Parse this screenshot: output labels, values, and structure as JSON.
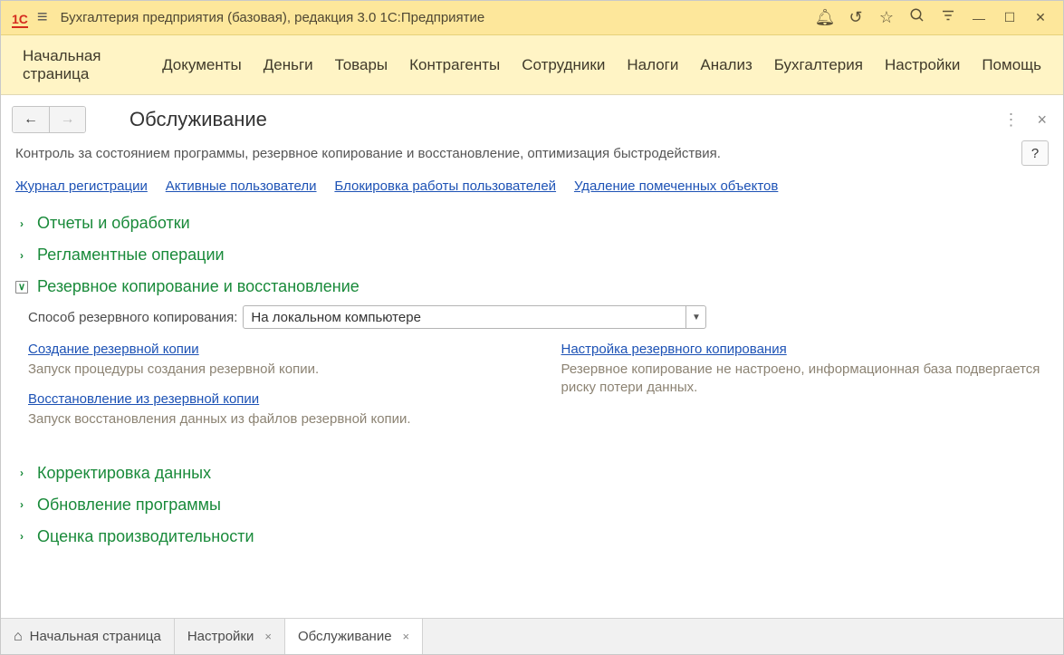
{
  "titlebar": {
    "logo_text": "1С",
    "app_title": "Бухгалтерия предприятия (базовая), редакция 3.0 1С:Предприятие"
  },
  "mainmenu": [
    "Начальная страница",
    "Документы",
    "Деньги",
    "Товары",
    "Контрагенты",
    "Сотрудники",
    "Налоги",
    "Анализ",
    "Бухгалтерия",
    "Настройки",
    "Помощь"
  ],
  "page": {
    "title": "Обслуживание",
    "description": "Контроль за состоянием программы, резервное копирование и восстановление, оптимизация быстродействия.",
    "help_label": "?"
  },
  "top_links": [
    "Журнал регистрации",
    "Активные пользователи",
    "Блокировка работы пользователей",
    "Удаление помеченных объектов"
  ],
  "sections": {
    "s1": "Отчеты и обработки",
    "s2": "Регламентные операции",
    "s3": "Резервное копирование и восстановление",
    "s4": "Корректировка данных",
    "s5": "Обновление программы",
    "s6": "Оценка производительности"
  },
  "backup": {
    "method_label": "Способ резервного копирования:",
    "method_value": "На локальном компьютере",
    "left": {
      "link1": "Создание резервной копии",
      "desc1": "Запуск процедуры создания резервной копии.",
      "link2": "Восстановление из резервной копии",
      "desc2": "Запуск восстановления данных из файлов резервной копии."
    },
    "right": {
      "link1": "Настройка резервного копирования",
      "desc1": "Резервное копирование не настроено, информационная база подвергается риску потери данных."
    }
  },
  "bottomtabs": {
    "t1": "Начальная страница",
    "t2": "Настройки",
    "t3": "Обслуживание"
  }
}
